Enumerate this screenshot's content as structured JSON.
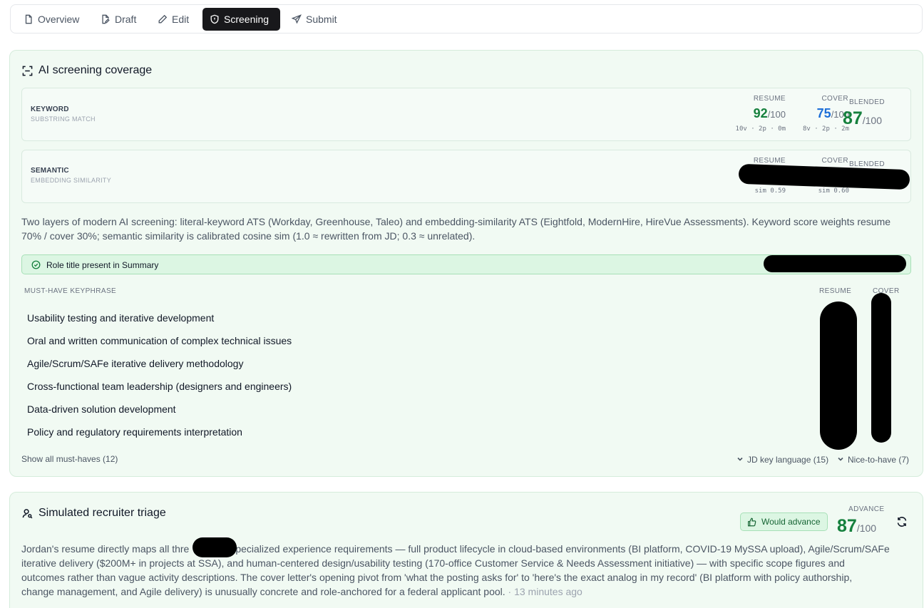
{
  "tabs": [
    {
      "label": "Overview",
      "icon": "file-icon",
      "active": false
    },
    {
      "label": "Draft",
      "icon": "file-edit-icon",
      "active": false
    },
    {
      "label": "Edit",
      "icon": "pencil-icon",
      "active": false
    },
    {
      "label": "Screening",
      "icon": "shield-icon",
      "active": true
    },
    {
      "label": "Submit",
      "icon": "send-icon",
      "active": false
    }
  ],
  "coverage": {
    "title": "AI screening coverage",
    "keyword": {
      "label": "KEYWORD",
      "sublabel": "SUBSTRING MATCH",
      "resume_head": "RESUME",
      "cover_head": "COVER",
      "blended_head": "BLENDED",
      "resume_score": "92",
      "cover_score": "75",
      "blended_score": "87",
      "denominator": "/100",
      "resume_detail": "10v · 2p · 0m",
      "cover_detail": "8v · 2p · 2m"
    },
    "semantic": {
      "label": "SEMANTIC",
      "sublabel": "EMBEDDING SIMILARITY",
      "resume_head": "RESUME",
      "cover_head": "COVER",
      "blended_head": "BLENDED",
      "resume_detail": "sim 0.59",
      "cover_detail": "sim 0.60"
    },
    "description": "Two layers of modern AI screening: literal-keyword ATS (Workday, Greenhouse, Taleo) and embedding-similarity ATS (Eightfold, ModernHire, HireVue Assessments). Keyword score weights resume 70% / cover 30%; semantic similarity is calibrated cosine sim (1.0 ≈ rewritten from JD; 0.3 ≈ unrelated).",
    "role_title_status": "Role title present in Summary",
    "musthave_head": "MUST-HAVE KEYPHRASE",
    "musthave_resume_head": "RESUME",
    "musthave_cover_head": "COVER",
    "keyphrases": [
      "Usability testing and iterative development",
      "Oral and written communication of complex technical issues",
      "Agile/Scrum/SAFe iterative delivery methodology",
      "Cross-functional team leadership (designers and engineers)",
      "Data-driven solution development",
      "Policy and regulatory requirements interpretation"
    ],
    "show_all": "Show all must-haves (12)",
    "jd_key_language": "JD key language (15)",
    "nice_to_have": "Nice-to-have (7)"
  },
  "triage": {
    "title": "Simulated recruiter triage",
    "verdict": "Would advance",
    "advance_head": "ADVANCE",
    "score": "87",
    "denominator": "/100",
    "summary_line1": "Jordan's resume directly maps all thre",
    "summary_line1b": "specialized experience requirements — full product lifecycle in cloud-based environments (BI platform, COVID-19 MySSA upload), Agile/Scrum/SAFe",
    "summary_line2": "iterative delivery ($200M+ in projects at SSA), and human-centered design/usability testing (170-office Customer Service & Needs Assessment initiative) — with specific scope figures and",
    "summary_line3": "outcomes rather than vague activity descriptions. The cover letter's opening pivot from 'what the posting asks for' to 'here's the exact analog in my record' (BI platform with policy authorship,",
    "summary_line4": "change management, and Agile delivery) is unusually concrete and role-anchored for a federal applicant pool.",
    "timestamp": "· 13 minutes ago"
  },
  "colors": {
    "score_green": "#15803d",
    "score_blue": "#1d6fd8",
    "panel_bg": "#f1faf3",
    "active_tab_bg": "#18181b"
  }
}
